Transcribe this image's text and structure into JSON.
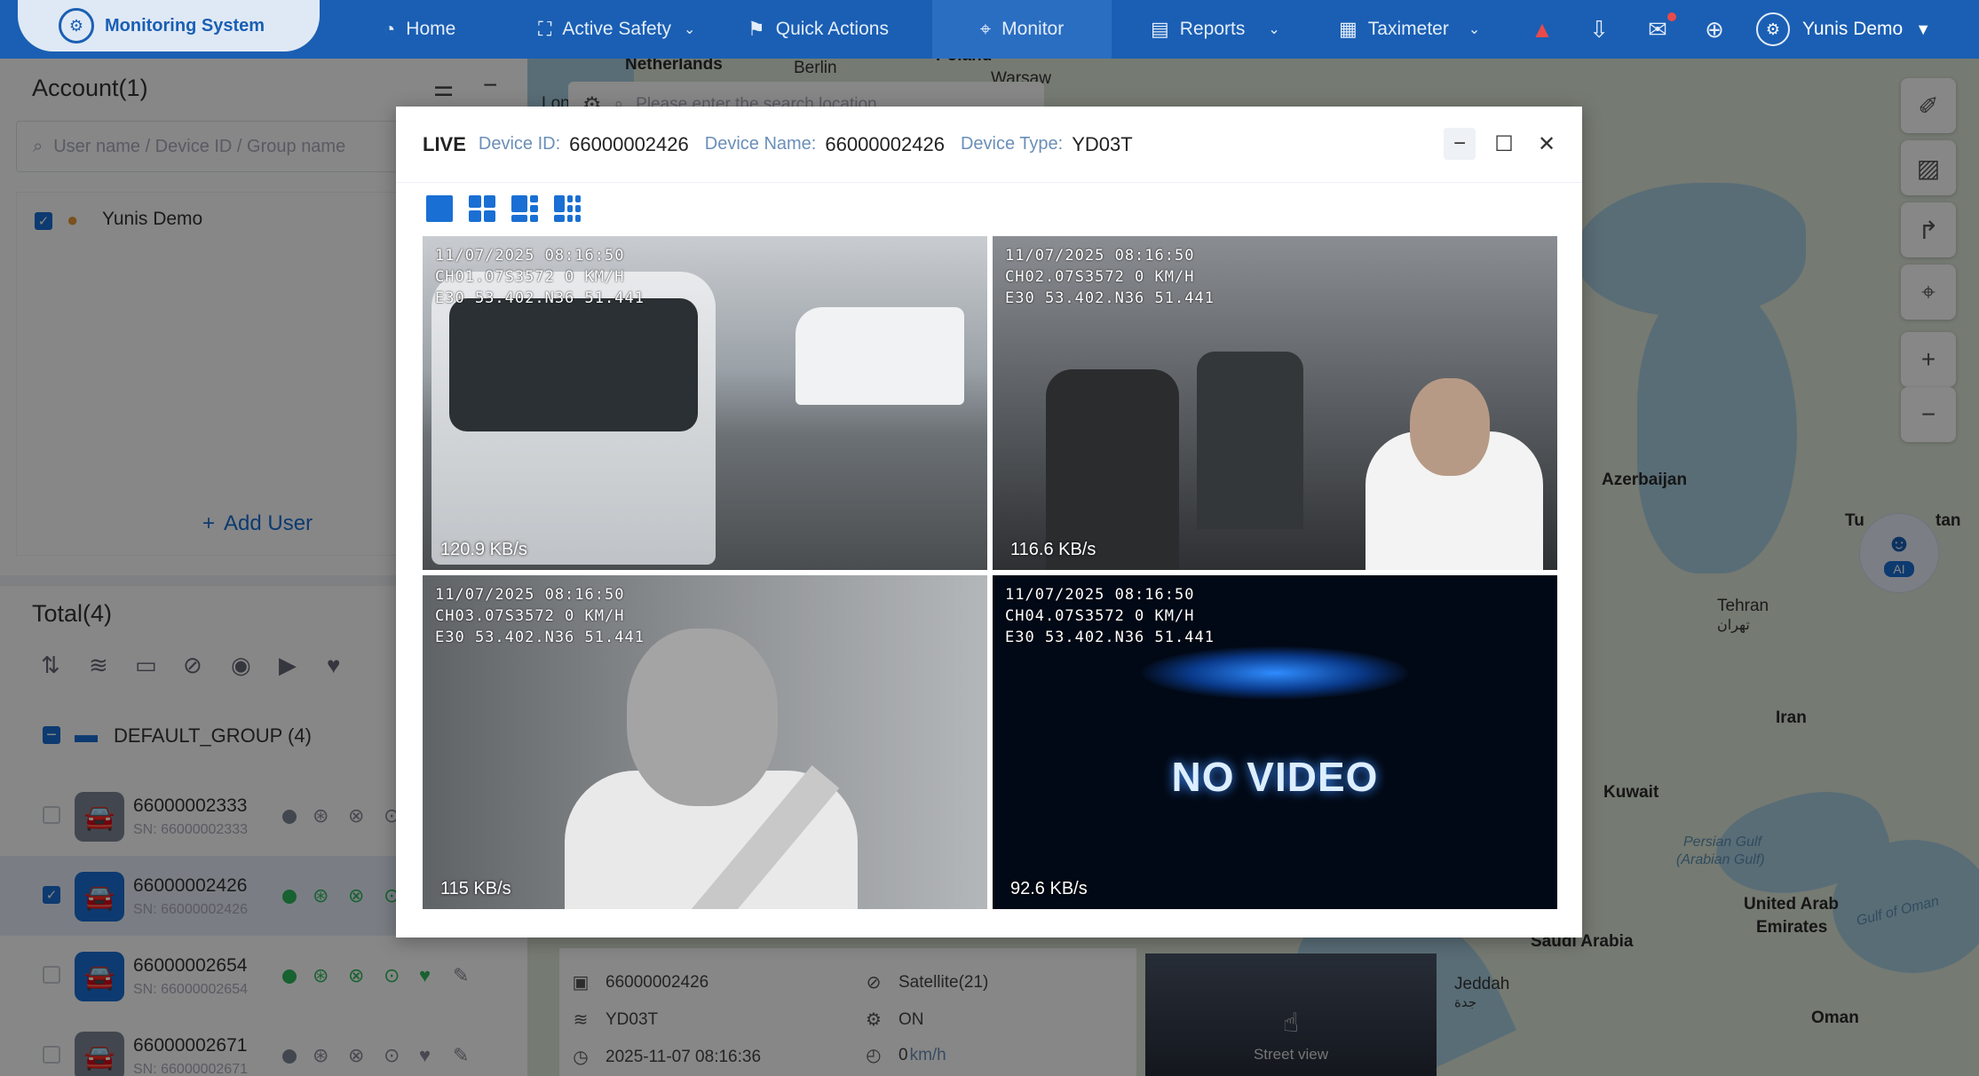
{
  "app": {
    "title": "Monitoring System"
  },
  "nav": {
    "home": "Home",
    "active_safety": "Active Safety",
    "quick_actions": "Quick Actions",
    "monitor": "Monitor",
    "reports": "Reports",
    "taximeter": "Taximeter"
  },
  "user": {
    "name": "Yunis Demo"
  },
  "account": {
    "title": "Account(1)",
    "search_placeholder": "User name / Device ID / Group name",
    "users": [
      "Yunis Demo"
    ],
    "add_user": "Add User"
  },
  "total": {
    "title": "Total(4)"
  },
  "group": {
    "name": "DEFAULT_GROUP (4)"
  },
  "vehicles": [
    {
      "name": "66000002333",
      "sn": "SN: 66000002333",
      "checked": false,
      "status_color": "#7d8795",
      "icon_color": "#7d8795"
    },
    {
      "name": "66000002426",
      "sn": "SN: 66000002426",
      "checked": true,
      "status_color": "#2eb85c",
      "icon_color": "#1a6fd4"
    },
    {
      "name": "66000002654",
      "sn": "SN: 66000002654",
      "checked": false,
      "status_color": "#2eb85c",
      "icon_color": "#1a6fd4"
    },
    {
      "name": "66000002671",
      "sn": "SN: 66000002671",
      "checked": false,
      "status_color": "#7d8795",
      "icon_color": "#7d8795"
    }
  ],
  "map": {
    "search_placeholder": "Please enter the search location",
    "labels": {
      "netherlands": "Netherlands",
      "berlin": "Berlin",
      "poland": "Poland",
      "warsaw": "Warsaw",
      "azerbaijan": "Azerbaijan",
      "turkmenistan_a": "Tu",
      "turkmenistan_b": "tan",
      "tehran": "Tehran",
      "tehran_fa": "تهران",
      "iran": "Iran",
      "kuwait": "Kuwait",
      "persian_gulf": "Persian Gulf",
      "arabian_gulf": "(Arabian Gulf)",
      "uae": "United Arab",
      "uae2": "Emirates",
      "gulf_oman": "Gulf of Oman",
      "saudi": "Saudi Arabia",
      "jeddah": "Jeddah",
      "jeddah_ar": "جدة",
      "oman": "Oman",
      "lon": "Lon"
    }
  },
  "ai": {
    "label": "AI"
  },
  "device_info": {
    "id": "66000002426",
    "type": "YD03T",
    "time": "2025-11-07 08:16:36",
    "satellite": "Satellite(21)",
    "acc": "ON",
    "speed_value": "0",
    "speed_unit": "km/h",
    "street_view": "Street view"
  },
  "modal": {
    "live": "LIVE",
    "device_id_label": "Device ID:",
    "device_id": "66000002426",
    "device_name_label": "Device Name:",
    "device_name": "66000002426",
    "device_type_label": "Device Type:",
    "device_type": "YD03T",
    "channels": [
      {
        "osd1": "11/07/2025 08:16:50",
        "osd2": "CH01.07S3572 0 KM/H",
        "osd3": "E30 53.402.N36 51.441",
        "rate": "120.9 KB/s",
        "scene": "bus-yard"
      },
      {
        "osd1": "11/07/2025 08:16:50",
        "osd2": "CH02.07S3572 0 KM/H",
        "osd3": "E30 53.402.N36 51.441",
        "rate": "116.6 KB/s",
        "scene": "cabin"
      },
      {
        "osd1": "11/07/2025 08:16:50",
        "osd2": "CH03.07S3572 0 KM/H",
        "osd3": "E30 53.402.N36 51.441",
        "rate": "115 KB/s",
        "scene": "driver"
      },
      {
        "osd1": "11/07/2025 08:16:50",
        "osd2": "CH04.07S3572 0 KM/H",
        "osd3": "E30 53.402.N36 51.441",
        "rate": "92.6 KB/s",
        "scene": "no-video"
      }
    ],
    "no_video": "NO VIDEO"
  },
  "colors": {
    "primary": "#1a5fb4",
    "accent": "#1a6fd4",
    "online": "#2eb85c"
  }
}
